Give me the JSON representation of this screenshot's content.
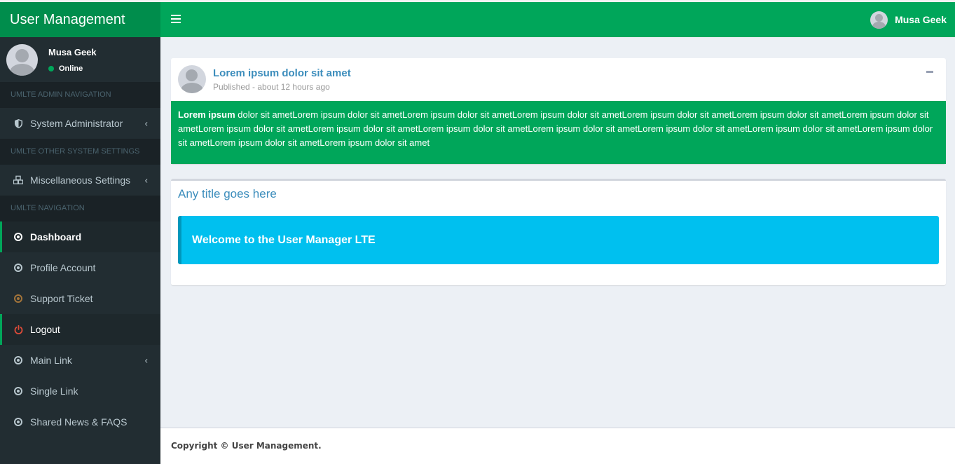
{
  "app": {
    "logo": "User Management"
  },
  "navbar": {
    "user_name": "Musa Geek"
  },
  "sidebar": {
    "user": {
      "name": "Musa Geek",
      "status": "Online"
    },
    "sections": [
      {
        "header": "UMLTE ADMIN NAVIGATION"
      },
      {
        "header": "UMLTE OTHER SYSTEM SETTINGS"
      },
      {
        "header": "UMLTE NAVIGATION"
      }
    ],
    "items": [
      {
        "label": "System Administrator",
        "icon": "shield-icon"
      },
      {
        "label": "Miscellaneous Settings",
        "icon": "cubes-icon"
      },
      {
        "label": "Dashboard",
        "icon": "circle-dot-icon"
      },
      {
        "label": "Profile Account",
        "icon": "circle-dot-icon"
      },
      {
        "label": "Support Ticket",
        "icon": "circle-dot-icon"
      },
      {
        "label": "Logout",
        "icon": "power-icon"
      },
      {
        "label": "Main Link",
        "icon": "circle-dot-icon"
      },
      {
        "label": "Single Link",
        "icon": "circle-dot-icon"
      },
      {
        "label": "Shared News & FAQS",
        "icon": "circle-dot-icon"
      }
    ]
  },
  "post": {
    "title": "Lorem ipsum dolor sit amet",
    "meta": "Published - about 12 hours ago",
    "body_lead": "Lorem ipsum",
    "body_rest": " dolor sit ametLorem ipsum dolor sit ametLorem ipsum dolor sit ametLorem ipsum dolor sit ametLorem ipsum dolor sit ametLorem ipsum dolor sit ametLorem ipsum dolor sit ametLorem ipsum dolor sit ametLorem ipsum dolor sit ametLorem ipsum dolor sit ametLorem ipsum dolor sit ametLorem ipsum dolor sit ametLorem ipsum dolor sit ametLorem ipsum dolor sit ametLorem ipsum dolor sit ametLorem ipsum dolor sit amet"
  },
  "panel": {
    "title": "Any title goes here",
    "callout": "Welcome to the User Manager LTE"
  },
  "footer": {
    "text": "Copyright © User Management."
  },
  "colors": {
    "brand_green": "#00a65a",
    "brand_green_dark": "#008d4c",
    "sidebar_bg": "#222d32",
    "callout_blue": "#00c0ef",
    "title_blue": "#3c8dbc"
  }
}
